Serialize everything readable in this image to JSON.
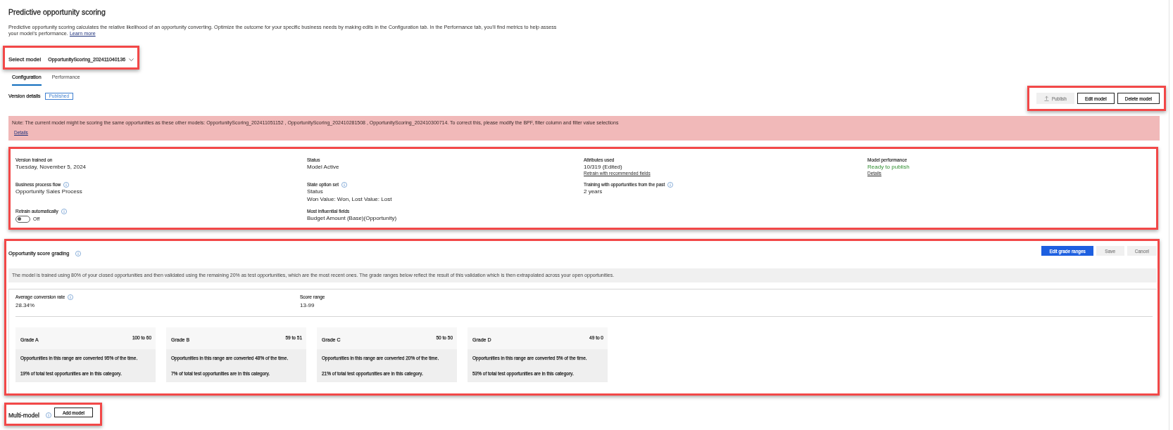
{
  "header": {
    "title": "Predictive opportunity scoring",
    "description": "Predictive opportunity scoring calculates the relative likelihood of an opportunity converting. Optimize the outcome for your specific business needs by making edits in the Configuration tab. In the Performance tab, you'll find metrics to help assess your model's performance.",
    "link": "Learn more"
  },
  "model_select": {
    "label": "Select model",
    "value": "OpportunityScoring_202411040136",
    "highlighted": true
  },
  "tabs": [
    {
      "label": "Configuration",
      "selected": true
    },
    {
      "label": "Performance",
      "selected": false
    }
  ],
  "version": {
    "label": "Version details",
    "badge": "Published"
  },
  "actions": {
    "highlighted": true,
    "buttons": [
      {
        "label": "Publish",
        "kind": "icon",
        "disabled": true
      },
      {
        "label": "Edit model",
        "kind": "outline",
        "disabled": false
      },
      {
        "label": "Delete model",
        "kind": "outline",
        "disabled": false
      }
    ]
  },
  "notice": {
    "text": "Note: The current model might be scoring the same opportunities as these other models: OpportunityScoring_202411051152 , OpportunityScoring_202410281508 , OpportunityScoring_202410300714. To correct this, please modify the BPF, filter column and filter value selections",
    "link": "Details"
  },
  "details": {
    "highlighted": true,
    "rows": [
      [
        {
          "label": "Version trained on",
          "info": false,
          "kind": "text",
          "values": [
            "Tuesday, November 5, 2024"
          ]
        },
        {
          "label": "Status",
          "info": false,
          "kind": "text",
          "values": [
            "Model Active"
          ]
        },
        {
          "label": "Attributes used",
          "info": false,
          "kind": "text",
          "values": [
            "10/319 (Edited)"
          ],
          "link": "Retrain with recommended fields"
        },
        {
          "label": "Model performance",
          "info": false,
          "kind": "status",
          "values": [
            "Ready to publish"
          ],
          "link": "Details"
        }
      ],
      [
        {
          "label": "Business process flow",
          "info": true,
          "kind": "text",
          "values": [
            "Opportunity Sales Process"
          ]
        },
        {
          "label": "State option set",
          "info": true,
          "kind": "text",
          "values": [
            "Status",
            "Won Value: Won, Lost Value: Lost"
          ]
        },
        {
          "label": "Training with opportunities from the past",
          "info": true,
          "kind": "text",
          "values": [
            "2 years"
          ]
        }
      ],
      [
        {
          "label": "Retrain automatically",
          "info": true,
          "kind": "toggle",
          "on": false,
          "values": [
            "Off"
          ]
        },
        {
          "label": "Most influential fields",
          "info": false,
          "kind": "text",
          "values": [
            "Budget Amount (Base)(Opportunity)"
          ]
        }
      ]
    ]
  },
  "grading": {
    "title": "Opportunity score grading",
    "info": true,
    "highlighted": true,
    "buttons": [
      {
        "label": "Edit grade ranges",
        "kind": "primary",
        "disabled": false
      },
      {
        "label": "Save",
        "kind": "primary",
        "disabled": true
      },
      {
        "label": "Cancel",
        "kind": "outline",
        "disabled": true
      }
    ],
    "note": "The model is trained using 80% of your closed opportunities and then validated using the remaining 20% as test opportunities, which are the most recent ones. The grade ranges below reflect the result of this validation which is then extrapolated across your open opportunities.",
    "stats": [
      {
        "label": "Average conversion rate",
        "info": true,
        "value": "28.34%"
      },
      {
        "label": "Score range",
        "info": false,
        "value": "13-99"
      }
    ],
    "grades": [
      {
        "name": "Grade A",
        "range": "100 to 60",
        "conversion": "Opportunities in this range are converted 95% of the time.",
        "share": "19% of total test opportunities are in this category."
      },
      {
        "name": "Grade B",
        "range": "59 to 51",
        "conversion": "Opportunities in this range are converted 48% of the time.",
        "share": "7% of total test opportunities are in this category."
      },
      {
        "name": "Grade C",
        "range": "50 to 50",
        "conversion": "Opportunities in this range are converted 20% of the time.",
        "share": "21% of total test opportunities are in this category."
      },
      {
        "name": "Grade D",
        "range": "49 to 0",
        "conversion": "Opportunities in this range are converted 5% of the time.",
        "share": "53% of total test opportunities are in this category."
      }
    ]
  },
  "multi_model": {
    "title": "Multi-model",
    "info": true,
    "highlighted": true,
    "button": {
      "label": "Add model",
      "kind": "outline",
      "disabled": false
    }
  }
}
